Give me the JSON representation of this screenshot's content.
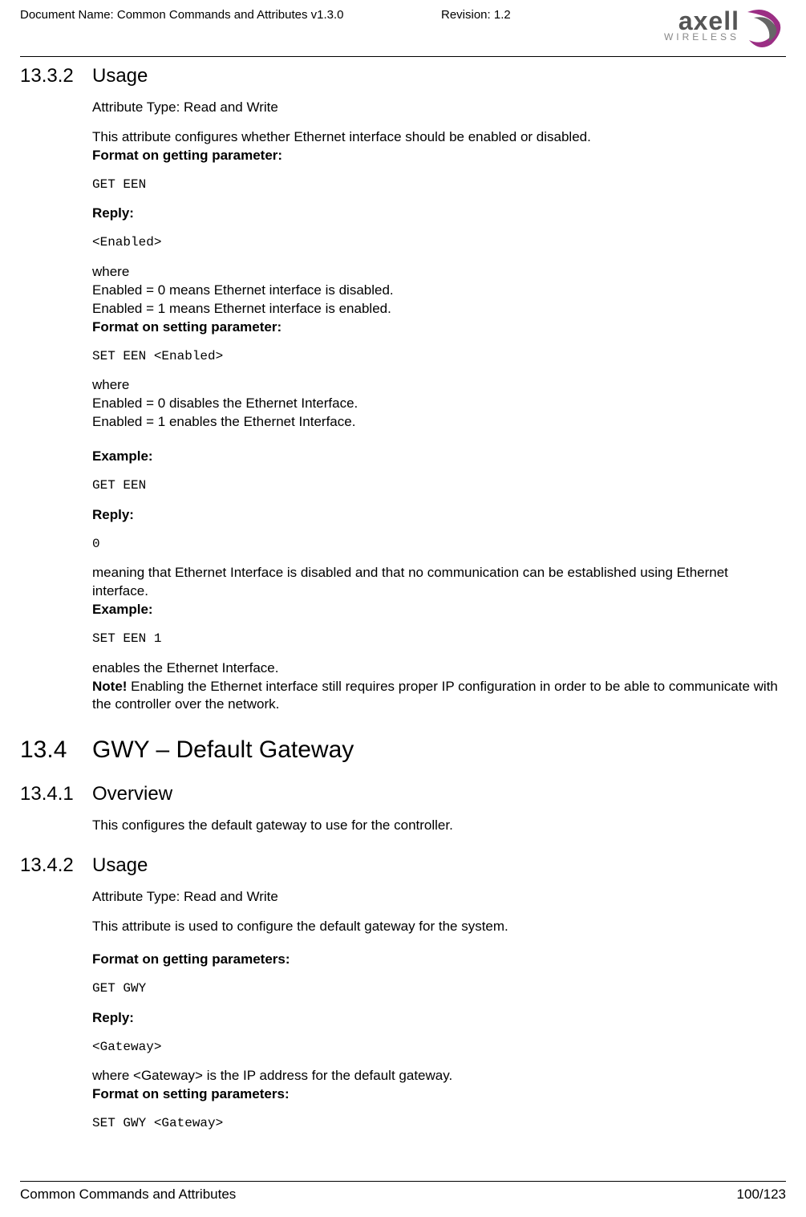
{
  "header": {
    "doc_name": "Document Name: Common Commands and Attributes v1.3.0",
    "revision": "Revision: 1.2",
    "logo_text": "axell",
    "logo_sub": "WIRELESS"
  },
  "s1332": {
    "num": "13.3.2",
    "title": "Usage",
    "attr_type": "Attribute Type: Read and Write",
    "intro": "This attribute configures whether Ethernet interface should be enabled or disabled.",
    "fmt_get_label": "Format on getting parameter:",
    "fmt_get_cmd": "GET EEN",
    "reply_label": "Reply:",
    "reply_val": "<Enabled>",
    "where1": "where",
    "where1_l1": "Enabled = 0 means Ethernet interface is disabled.",
    "where1_l2": "Enabled = 1 means Ethernet interface is enabled.",
    "fmt_set_label": "Format on setting parameter:",
    "fmt_set_cmd": "SET EEN <Enabled>",
    "where2": "where",
    "where2_l1": "Enabled = 0 disables the Ethernet Interface.",
    "where2_l2": "Enabled = 1 enables the Ethernet Interface.",
    "example1_label": "Example:",
    "example1_cmd": "GET EEN",
    "reply2_label": "Reply:",
    "reply2_val": "0",
    "meaning": "meaning that Ethernet Interface is disabled and that no communication can be established using Ethernet interface.",
    "example2_label": "Example:",
    "example2_cmd": "SET EEN 1",
    "enables": "enables the Ethernet Interface.",
    "note_label": "Note!",
    "note_text": " Enabling the Ethernet interface still requires proper IP configuration in order to be able to communicate with the controller over the network."
  },
  "s134": {
    "num": "13.4",
    "title": "GWY – Default Gateway"
  },
  "s1341": {
    "num": "13.4.1",
    "title": "Overview",
    "text": "This configures the default gateway to use for the controller."
  },
  "s1342": {
    "num": "13.4.2",
    "title": "Usage",
    "attr_type": "Attribute Type: Read and Write",
    "intro": "This attribute is used to configure the default gateway for the system.",
    "fmt_get_label": "Format on getting parameters:",
    "fmt_get_cmd": "GET GWY",
    "reply_label": "Reply:",
    "reply_val": "<Gateway>",
    "where_text": "where <Gateway> is the IP address for the default gateway.",
    "fmt_set_label": "Format on setting parameters:",
    "fmt_set_cmd": "SET GWY <Gateway>"
  },
  "footer": {
    "title": "Common Commands and Attributes",
    "page": "100/123"
  }
}
